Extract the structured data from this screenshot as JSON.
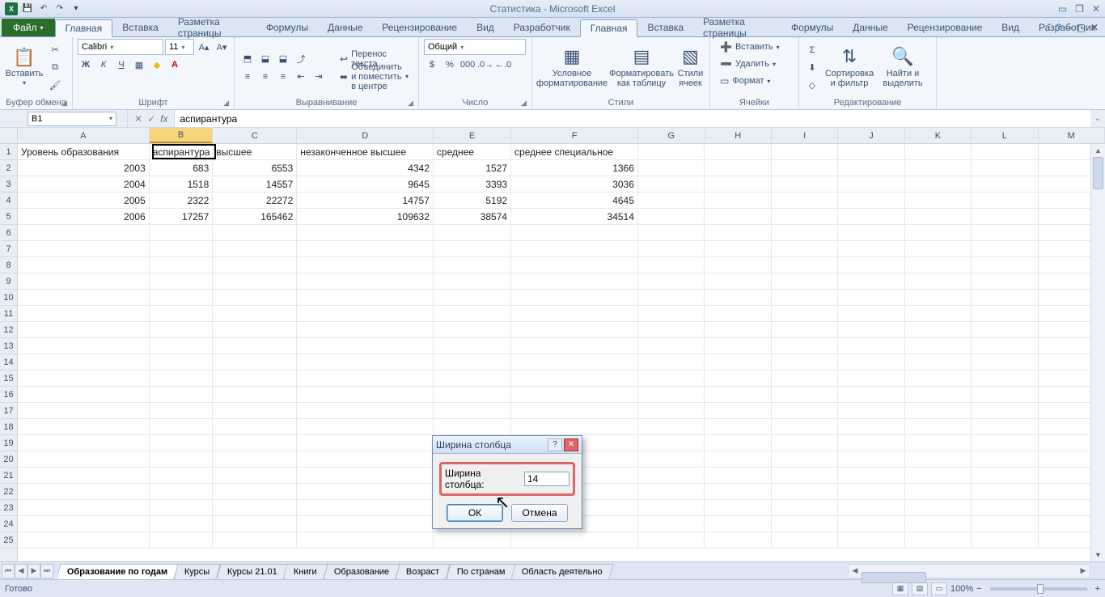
{
  "titlebar": {
    "title": "Статистика - Microsoft Excel"
  },
  "ribbon": {
    "file": "Файл",
    "tabs": [
      "Главная",
      "Вставка",
      "Разметка страницы",
      "Формулы",
      "Данные",
      "Рецензирование",
      "Вид",
      "Разработчик"
    ],
    "active": "Главная",
    "groups": {
      "clipboard": {
        "label": "Буфер обмена",
        "paste": "Вставить"
      },
      "font": {
        "label": "Шрифт",
        "name": "Calibri",
        "size": "11"
      },
      "alignment": {
        "label": "Выравнивание",
        "wrap": "Перенос текста",
        "merge": "Объединить и поместить в центре"
      },
      "number": {
        "label": "Число",
        "format": "Общий"
      },
      "styles": {
        "label": "Стили",
        "cond": "Условное форматирование",
        "table": "Форматировать как таблицу",
        "cell": "Стили ячеек"
      },
      "cells": {
        "label": "Ячейки",
        "insert": "Вставить",
        "delete": "Удалить",
        "format": "Формат"
      },
      "editing": {
        "label": "Редактирование",
        "sort": "Сортировка и фильтр",
        "find": "Найти и выделить"
      }
    }
  },
  "namebox": "B1",
  "formula": "аспирантура",
  "columns": [
    "A",
    "B",
    "C",
    "D",
    "E",
    "F",
    "G",
    "H",
    "I",
    "J",
    "K",
    "L",
    "M"
  ],
  "selected_column": "B",
  "rows_count": 25,
  "data_rows": [
    {
      "A": "Уровень образования",
      "B": "аспирантура",
      "C": "высшее",
      "D": "незаконченное высшее",
      "E": "среднее",
      "F": "среднее специальное"
    },
    {
      "A": "2003",
      "B": "683",
      "C": "6553",
      "D": "4342",
      "E": "1527",
      "F": "1366"
    },
    {
      "A": "2004",
      "B": "1518",
      "C": "14557",
      "D": "9645",
      "E": "3393",
      "F": "3036"
    },
    {
      "A": "2005",
      "B": "2322",
      "C": "22272",
      "D": "14757",
      "E": "5192",
      "F": "4645"
    },
    {
      "A": "2006",
      "B": "17257",
      "C": "165462",
      "D": "109632",
      "E": "38574",
      "F": "34514"
    }
  ],
  "dialog": {
    "title": "Ширина столбца",
    "label": "Ширина столбца:",
    "value": "14",
    "ok": "ОК",
    "cancel": "Отмена"
  },
  "sheet_tabs": [
    "Образование по годам",
    "Курсы",
    "Курсы 21.01",
    "Книги",
    "Образование",
    "Возраст",
    "По странам",
    "Область деятельно"
  ],
  "active_sheet": "Образование по годам",
  "status": {
    "ready": "Готово",
    "zoom": "100%"
  }
}
